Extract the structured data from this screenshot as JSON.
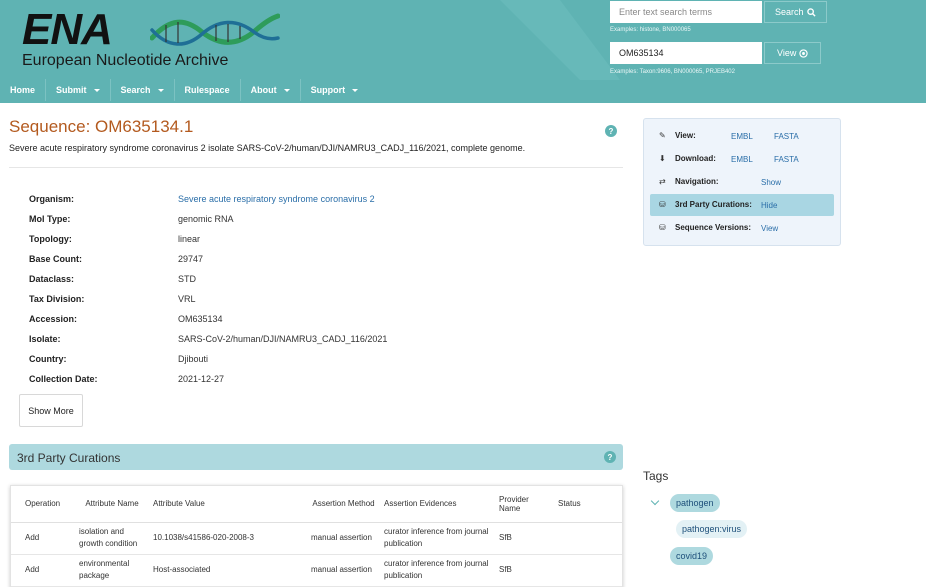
{
  "header": {
    "logo_text": "ENA",
    "logo_subtitle": "European Nucleotide Archive",
    "text_search": {
      "placeholder": "Enter text search terms",
      "button_label": "Search",
      "examples": "Examples: histone, BN000065"
    },
    "accession_search": {
      "value": "OM635134",
      "button_label": "View",
      "examples": "Examples: Taxon:9606, BN000065, PRJEB402"
    },
    "nav": [
      {
        "label": "Home",
        "has_dropdown": false
      },
      {
        "label": "Submit",
        "has_dropdown": true
      },
      {
        "label": "Search",
        "has_dropdown": true
      },
      {
        "label": "Rulespace",
        "has_dropdown": false
      },
      {
        "label": "About",
        "has_dropdown": true
      },
      {
        "label": "Support",
        "has_dropdown": true
      }
    ]
  },
  "sequence": {
    "title": "Sequence: OM635134.1",
    "description": "Severe acute respiratory syndrome coronavirus 2 isolate SARS-CoV-2/human/DJI/NAMRU3_CADJ_116/2021, complete genome.",
    "metadata": [
      {
        "key": "Organism:",
        "value": "Severe acute respiratory syndrome coronavirus 2",
        "is_link": true
      },
      {
        "key": "Mol Type:",
        "value": "genomic RNA"
      },
      {
        "key": "Topology:",
        "value": "linear"
      },
      {
        "key": "Base Count:",
        "value": "29747"
      },
      {
        "key": "Dataclass:",
        "value": "STD"
      },
      {
        "key": "Tax Division:",
        "value": "VRL"
      },
      {
        "key": "Accession:",
        "value": "OM635134"
      },
      {
        "key": "Isolate:",
        "value": "SARS-CoV-2/human/DJI/NAMRU3_CADJ_116/2021"
      },
      {
        "key": "Country:",
        "value": "Djibouti"
      },
      {
        "key": "Collection Date:",
        "value": "2021-12-27"
      }
    ],
    "show_more_label": "Show More"
  },
  "curations": {
    "title": "3rd Party Curations",
    "columns": [
      "Operation",
      "Attribute Name",
      "Attribute Value",
      "Assertion Method",
      "Assertion Evidences",
      "Provider Name",
      "Status"
    ],
    "rows": [
      [
        "Add",
        "isolation and growth condition",
        "10.1038/s41586-020-2008-3",
        "manual assertion",
        "curator inference from journal publication",
        "SfB",
        ""
      ],
      [
        "Add",
        "environmental package",
        "Host-associated",
        "manual assertion",
        "curator inference from journal publication",
        "SfB",
        ""
      ]
    ]
  },
  "side_panel": {
    "view": {
      "label": "View:",
      "links": [
        "EMBL",
        "FASTA"
      ]
    },
    "download": {
      "label": "Download:",
      "links": [
        "EMBL",
        "FASTA"
      ]
    },
    "navigation": {
      "label": "Navigation:",
      "action": "Show"
    },
    "curations": {
      "label": "3rd Party Curations:",
      "action": "Hide"
    },
    "versions": {
      "label": "Sequence Versions:",
      "action": "View"
    }
  },
  "tags": {
    "title": "Tags",
    "items": [
      "pathogen",
      "pathogen:virus",
      "covid19"
    ]
  },
  "colors": {
    "header_bg": "#5fb3b3",
    "title": "#b35a1f",
    "link": "#2a6ea8",
    "bar_bg": "#aed9df"
  }
}
